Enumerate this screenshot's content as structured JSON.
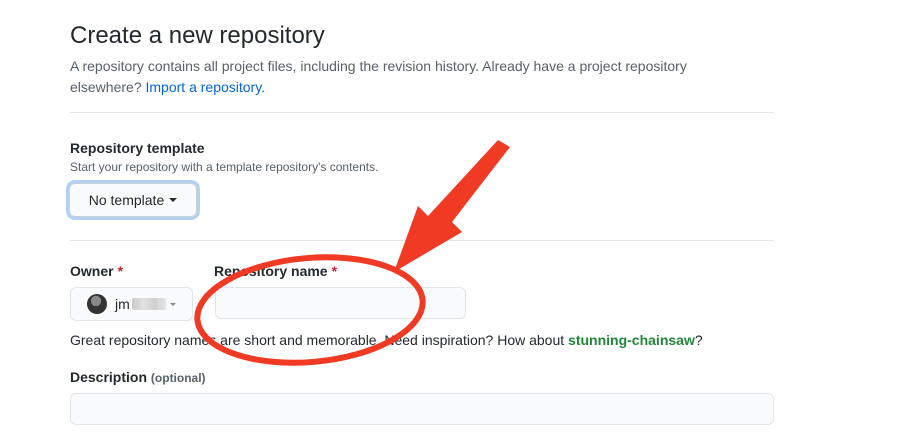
{
  "header": {
    "title": "Create a new repository",
    "intro_text": "A repository contains all project files, including the revision history. Already have a project repository elsewhere?",
    "import_link": "Import a repository."
  },
  "template": {
    "label": "Repository template",
    "note": "Start your repository with a template repository's contents.",
    "button_label": "No template"
  },
  "owner": {
    "label": "Owner",
    "required_marker": "*",
    "selected": "jm",
    "avatar_icon": "user-avatar"
  },
  "separator": "/",
  "repo_name": {
    "label": "Repository name",
    "required_marker": "*",
    "value": ""
  },
  "name_hint": {
    "text": "Great repository names are short and memorable. Need inspiration? How about",
    "suggestion": "stunning-chainsaw",
    "end": "?"
  },
  "description": {
    "label": "Description",
    "optional": "(optional)",
    "value": ""
  },
  "colors": {
    "annotation_red": "#f03a24",
    "link_blue": "#0366d6",
    "suggestion_green": "#22863a",
    "required_red": "#cb2431"
  }
}
